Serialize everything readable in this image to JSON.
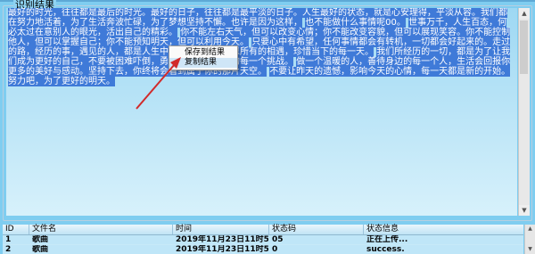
{
  "group": {
    "label": "识别结果"
  },
  "recognized_text": {
    "lines": [
      "最好的时光，往往都是最后的时光。最好的日子，往往都是最平淡的日子。人生最好的状态，就是心安理得，平淡从容。我们都在努力地活着，为了生活奔波忙碌，为了梦想坚持不懈。也许是因为这样，",
      "也不能做什么事情呢00。",
      "世事万千，人生百态，何必太过在意别人的眼光，活出自己的精彩。",
      "你不能左右天气，但可以改变心情；你不能改变容貌，但可以展现笑容。你不能控制他人，但可以掌握自己；你不能预知明天，但可以利用今天。",
      "只要心中有希望，任何事情都会有转机，一切都会好起来的。走过的路，经历的事，遇见的人，都是人生中宝贵的财富，感恩所有的相遇，珍惜当下的每一天。",
      "我们所经历的一切，都是为了让我们成为更好的自己，不要被困难吓倒，勇敢地面对生活中的每一个挑战。",
      "做一个温暖的人，善待身边的每一个人，生活会回报你更多的美好与感动。坚持下去，你终将会看到属于你的那片天空。",
      "不要让昨天的遗憾，影响今天的心情，每一天都是新的开始。努力吧，为了更好的明天。"
    ]
  },
  "context_menu": {
    "items": [
      {
        "label": "保存到结果"
      },
      {
        "label": "复制结果"
      }
    ]
  },
  "table": {
    "columns": [
      "ID",
      "文件名",
      "时间",
      "状态码",
      "状态信息"
    ],
    "rows": [
      {
        "id": "1",
        "filename": "歌曲",
        "time": "2019年11月23日11时54分...",
        "code": "05",
        "message": "正在上传..."
      },
      {
        "id": "2",
        "filename": "歌曲",
        "time": "2019年11月23日11时54分...",
        "code": "0",
        "message": "success."
      }
    ]
  },
  "colors": {
    "background": "#7fcdf0",
    "selection": "#3f7ad8",
    "annotation_arrow": "#d12a2a"
  }
}
